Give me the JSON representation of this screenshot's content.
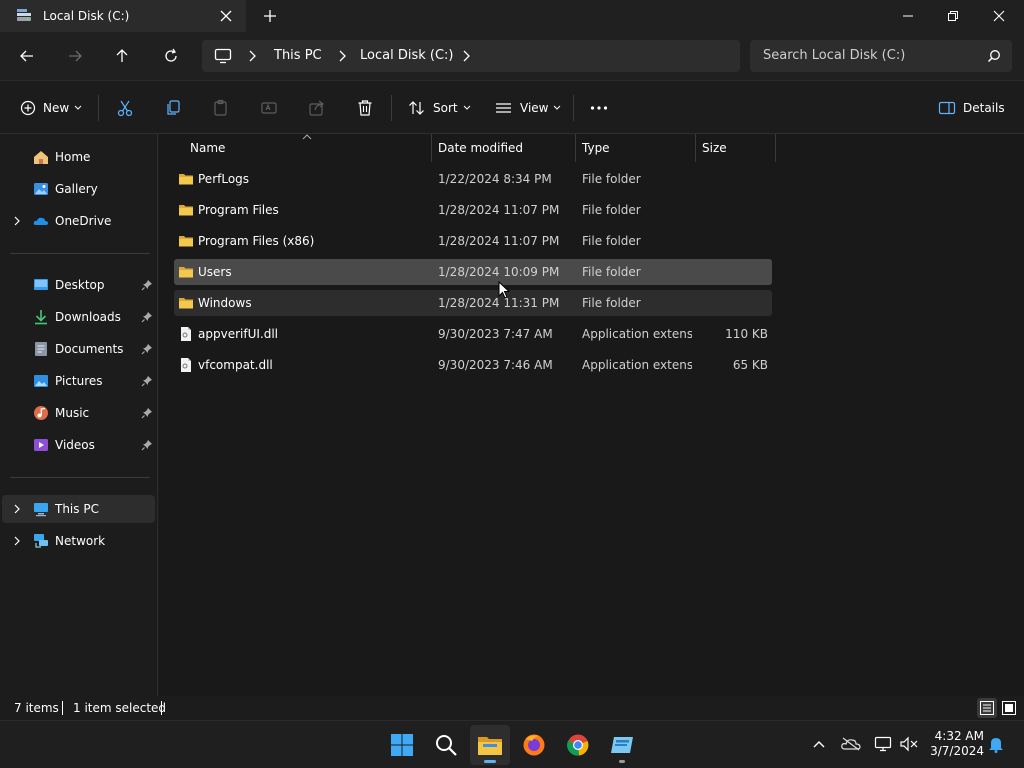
{
  "window": {
    "tab_title": "Local Disk (C:)"
  },
  "address": {
    "crumbs": [
      "This PC",
      "Local Disk (C:)"
    ],
    "search_placeholder": "Search Local Disk (C:)"
  },
  "commands": {
    "new": "New",
    "sort": "Sort",
    "view": "View",
    "details": "Details"
  },
  "sidebar": {
    "items": [
      {
        "label": "Home",
        "icon": "home-icon"
      },
      {
        "label": "Gallery",
        "icon": "gallery-icon"
      },
      {
        "label": "OneDrive",
        "icon": "onedrive-icon"
      },
      {
        "label": "Desktop",
        "icon": "desktop-icon"
      },
      {
        "label": "Downloads",
        "icon": "downloads-icon"
      },
      {
        "label": "Documents",
        "icon": "documents-icon"
      },
      {
        "label": "Pictures",
        "icon": "pictures-icon"
      },
      {
        "label": "Music",
        "icon": "music-icon"
      },
      {
        "label": "Videos",
        "icon": "videos-icon"
      },
      {
        "label": "This PC",
        "icon": "this-pc-icon"
      },
      {
        "label": "Network",
        "icon": "network-icon"
      }
    ]
  },
  "columns": {
    "name": "Name",
    "date": "Date modified",
    "type": "Type",
    "size": "Size"
  },
  "files": [
    {
      "name": "PerfLogs",
      "date": "1/22/2024 8:34 PM",
      "type": "File folder",
      "size": "",
      "kind": "folder"
    },
    {
      "name": "Program Files",
      "date": "1/28/2024 11:07 PM",
      "type": "File folder",
      "size": "",
      "kind": "folder"
    },
    {
      "name": "Program Files (x86)",
      "date": "1/28/2024 11:07 PM",
      "type": "File folder",
      "size": "",
      "kind": "folder"
    },
    {
      "name": "Users",
      "date": "1/28/2024 10:09 PM",
      "type": "File folder",
      "size": "",
      "kind": "folder"
    },
    {
      "name": "Windows",
      "date": "1/28/2024 11:31 PM",
      "type": "File folder",
      "size": "",
      "kind": "folder"
    },
    {
      "name": "appverifUI.dll",
      "date": "9/30/2023 7:47 AM",
      "type": "Application extens...",
      "size": "110 KB",
      "kind": "file"
    },
    {
      "name": "vfcompat.dll",
      "date": "9/30/2023 7:46 AM",
      "type": "Application extens...",
      "size": "65 KB",
      "kind": "file"
    }
  ],
  "status": {
    "items_count": "7 items",
    "selection": "1 item selected"
  },
  "clock": {
    "time": "4:32 AM",
    "date": "3/7/2024"
  },
  "colors": {
    "accent": "#5fb2f2",
    "folder": "#f2c94c",
    "selected_row": "#4a4a4a"
  }
}
